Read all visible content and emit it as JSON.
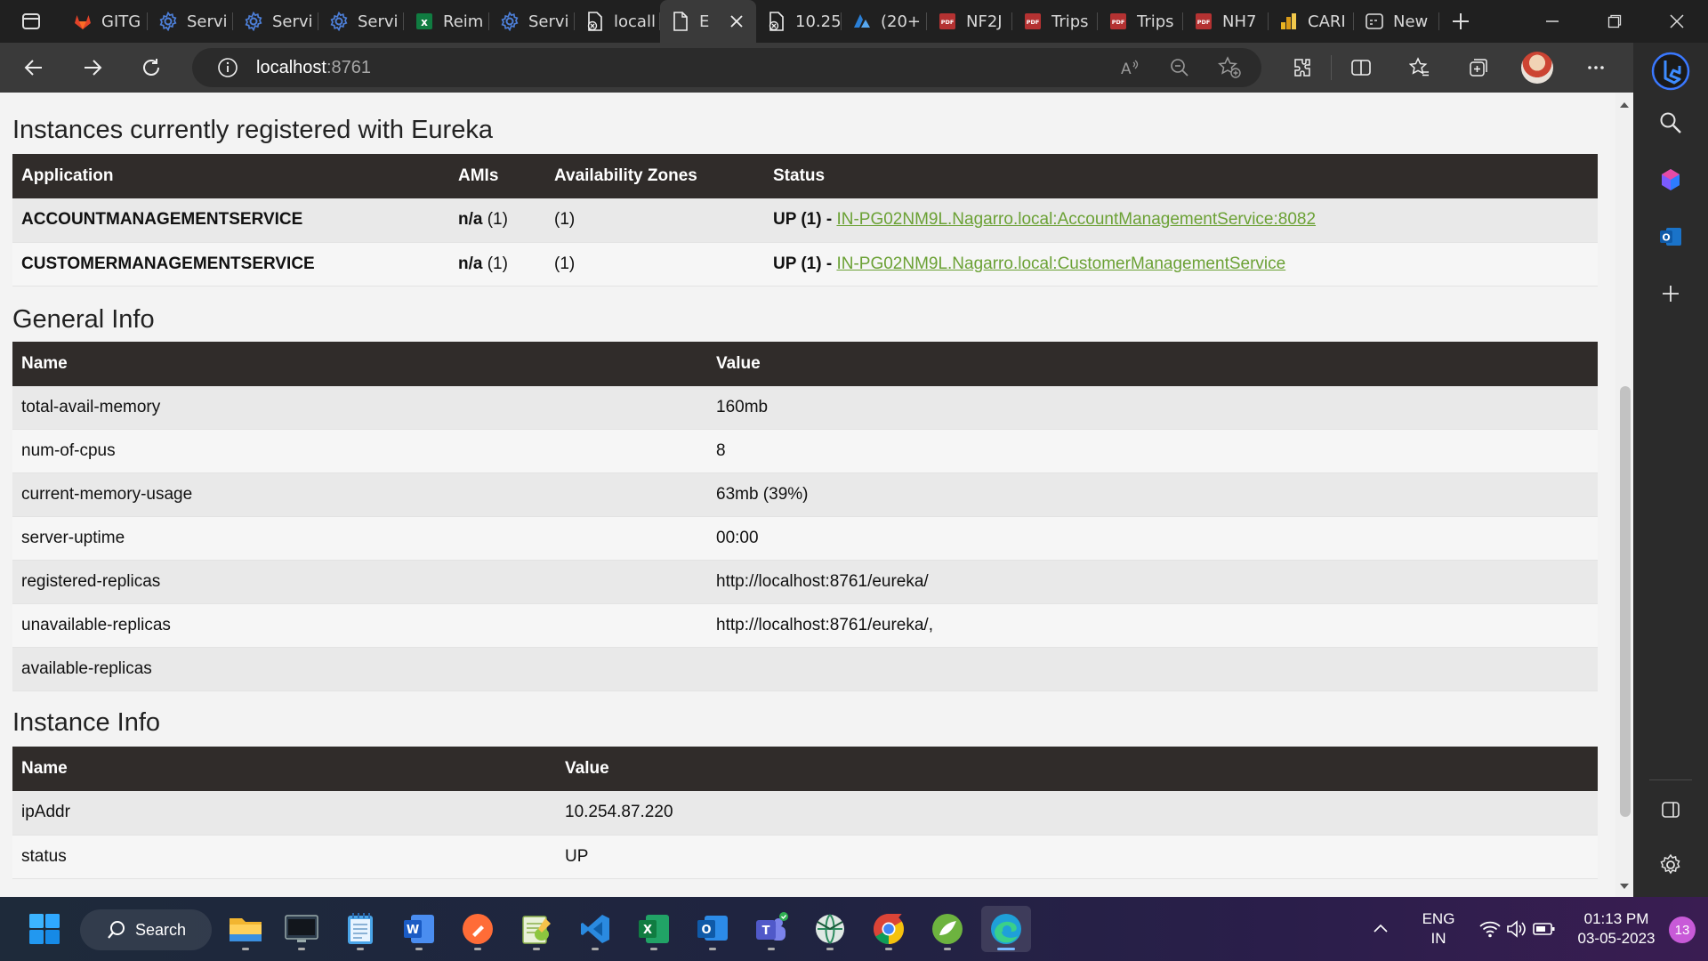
{
  "tabs": [
    {
      "label": "GITG",
      "icon": "gitlab-icon",
      "active": false
    },
    {
      "label": "Servi",
      "icon": "gear-icon",
      "active": false
    },
    {
      "label": "Servi",
      "icon": "gear-icon",
      "active": false
    },
    {
      "label": "Servi",
      "icon": "gear-icon",
      "active": false
    },
    {
      "label": "Reim",
      "icon": "excel-icon",
      "active": false
    },
    {
      "label": "Servi",
      "icon": "gear-icon",
      "active": false
    },
    {
      "label": "locall",
      "icon": "page-error-icon",
      "active": false
    },
    {
      "label": "E",
      "icon": "page-icon",
      "active": true
    },
    {
      "label": "10.25",
      "icon": "page-error-icon",
      "active": false
    },
    {
      "label": "(20+",
      "icon": "azure-icon",
      "active": false
    },
    {
      "label": "NF2J",
      "icon": "pdf-icon",
      "active": false
    },
    {
      "label": "Trips",
      "icon": "pdf-icon",
      "active": false
    },
    {
      "label": "Trips",
      "icon": "pdf-icon",
      "active": false
    },
    {
      "label": "NH7",
      "icon": "pdf-icon",
      "active": false
    },
    {
      "label": "CARI",
      "icon": "chart-icon",
      "active": false
    },
    {
      "label": "New",
      "icon": "newtab-icon",
      "active": false
    }
  ],
  "address": {
    "host": "localhost",
    "port": ":8761"
  },
  "instances": {
    "title": "Instances currently registered with Eureka",
    "headers": [
      "Application",
      "AMIs",
      "Availability Zones",
      "Status"
    ],
    "rows": [
      {
        "app": "ACCOUNTMANAGEMENTSERVICE",
        "amis_bold": "n/a",
        "amis_count": " (1)",
        "zones": "(1)",
        "status": "UP (1) - ",
        "link": "IN-PG02NM9L.Nagarro.local:AccountManagementService:8082"
      },
      {
        "app": "CUSTOMERMANAGEMENTSERVICE",
        "amis_bold": "n/a",
        "amis_count": " (1)",
        "zones": "(1)",
        "status": "UP (1) - ",
        "link": "IN-PG02NM9L.Nagarro.local:CustomerManagementService"
      }
    ]
  },
  "general_info": {
    "title": "General Info",
    "headers": [
      "Name",
      "Value"
    ],
    "rows": [
      {
        "name": "total-avail-memory",
        "value": "160mb"
      },
      {
        "name": "num-of-cpus",
        "value": "8"
      },
      {
        "name": "current-memory-usage",
        "value": "63mb (39%)"
      },
      {
        "name": "server-uptime",
        "value": "00:00"
      },
      {
        "name": "registered-replicas",
        "value": "http://localhost:8761/eureka/"
      },
      {
        "name": "unavailable-replicas",
        "value": "http://localhost:8761/eureka/,"
      },
      {
        "name": "available-replicas",
        "value": ""
      }
    ]
  },
  "instance_info": {
    "title": "Instance Info",
    "headers": [
      "Name",
      "Value"
    ],
    "rows": [
      {
        "name": "ipAddr",
        "value": "10.254.87.220"
      },
      {
        "name": "status",
        "value": "UP"
      }
    ]
  },
  "taskbar": {
    "search_label": "Search",
    "language": "ENG",
    "region": "IN",
    "time": "01:13 PM",
    "date": "03-05-2023",
    "notification_count": "13"
  },
  "colors": {
    "header_bg": "#302c2a",
    "link": "#6ba135",
    "accent": "#7ab8ff"
  }
}
